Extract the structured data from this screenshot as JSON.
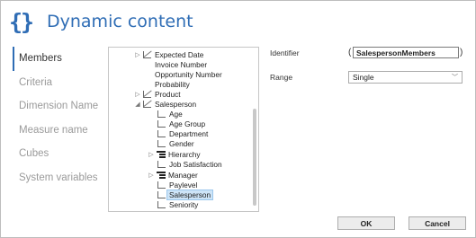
{
  "header": {
    "icon": "curly-braces-icon",
    "icon_glyph": "{}",
    "title": "Dynamic content"
  },
  "accent_color": "#2f6db5",
  "sidebar": {
    "items": [
      {
        "label": "Members"
      },
      {
        "label": "Criteria"
      },
      {
        "label": "Dimension Name"
      },
      {
        "label": "Measure name"
      },
      {
        "label": "Cubes"
      },
      {
        "label": "System variables"
      }
    ]
  },
  "tree": {
    "rows": [
      {
        "label": "Expected Date"
      },
      {
        "label": "Invoice Number"
      },
      {
        "label": "Opportunity Number"
      },
      {
        "label": "Probability"
      },
      {
        "label": "Product"
      },
      {
        "label": "Salesperson"
      },
      {
        "label": "Age"
      },
      {
        "label": "Age Group"
      },
      {
        "label": "Department"
      },
      {
        "label": "Gender"
      },
      {
        "label": "Hierarchy"
      },
      {
        "label": "Job Satisfaction"
      },
      {
        "label": "Manager"
      },
      {
        "label": "Paylevel"
      },
      {
        "label": "Salesperson"
      },
      {
        "label": "Seniority"
      }
    ]
  },
  "fields": {
    "identifier_label": "Identifier",
    "paren_open": "(",
    "paren_close": ")",
    "identifier_value": "SalespersonMembers",
    "range_label": "Range",
    "range_value": "Single"
  },
  "buttons": {
    "ok": "OK",
    "cancel": "Cancel"
  }
}
